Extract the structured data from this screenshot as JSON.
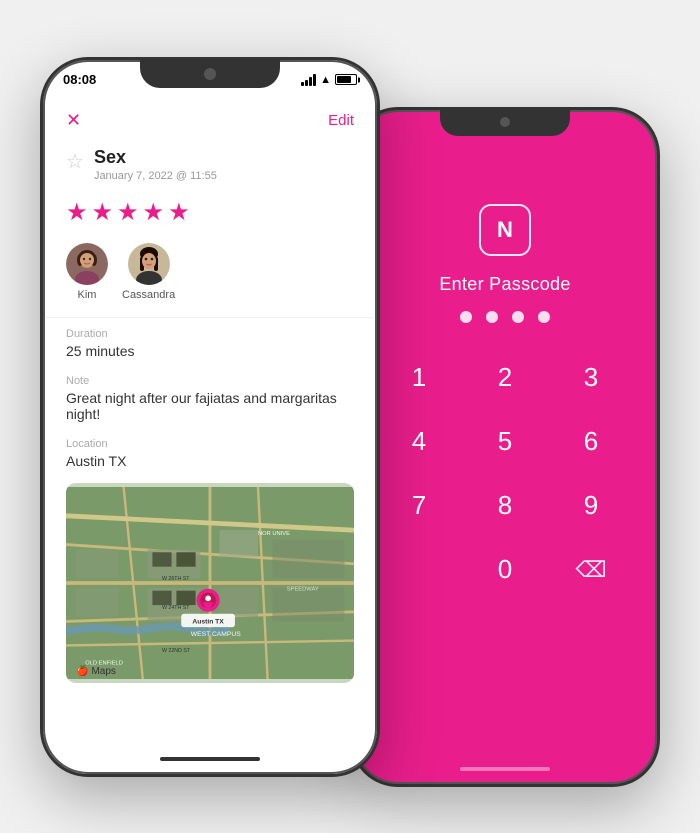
{
  "left_phone": {
    "status_bar": {
      "time": "08:08"
    },
    "header": {
      "close_label": "✕",
      "edit_label": "Edit"
    },
    "entry": {
      "title": "Sex",
      "date": "January 7, 2022 @ 11:55",
      "rating": 5,
      "stars": [
        "★",
        "★",
        "★",
        "★",
        "★"
      ]
    },
    "participants": [
      {
        "name": "Kim"
      },
      {
        "name": "Cassandra"
      }
    ],
    "duration": {
      "label": "Duration",
      "value": "25 minutes"
    },
    "note": {
      "label": "Note",
      "value": "Great night after our fajiatas and margaritas night!"
    },
    "location": {
      "label": "Location",
      "value": "Austin TX"
    },
    "map_watermark": "Maps"
  },
  "right_phone": {
    "logo_letter": "N",
    "title": "Enter Passcode",
    "dots_count": 4,
    "keypad": [
      [
        "1",
        "2",
        "3"
      ],
      [
        "4",
        "5",
        "6"
      ],
      [
        "7",
        "8",
        "9"
      ],
      [
        "",
        "0",
        "⌫"
      ]
    ]
  },
  "colors": {
    "brand_pink": "#e91e8c",
    "star_color": "#e91e8c",
    "text_dark": "#222222",
    "text_muted": "#999999"
  }
}
